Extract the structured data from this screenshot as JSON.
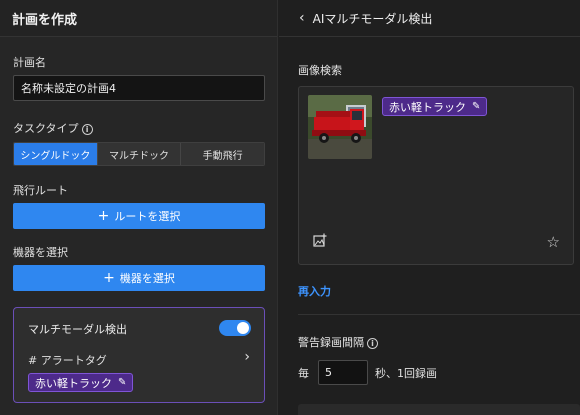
{
  "left": {
    "title": "計画を作成",
    "plan_name_label": "計画名",
    "plan_name_value": "名称未設定の計画4",
    "task_type_label": "タスクタイプ",
    "task_types": [
      "シングルドック",
      "マルチドック",
      "手動飛行"
    ],
    "task_type_selected": "シングルドック",
    "route_label": "飛行ルート",
    "route_button": "ルートを選択",
    "device_label": "機器を選択",
    "device_button": "機器を選択",
    "multimodal_label": "マルチモーダル検出",
    "multimodal_enabled": true,
    "alert_tag_label": "# アラートタグ",
    "alert_tag_value": "赤い軽トラック"
  },
  "right": {
    "title": "AIマルチモーダル検出",
    "image_search_label": "画像検索",
    "tag_value": "赤い軽トラック",
    "reenter_link": "再入力",
    "interval_label": "警告録画間隔",
    "interval_prefix": "毎",
    "interval_value": "5",
    "interval_suffix": "秒、1回録画"
  },
  "icons": {
    "info": "info-icon",
    "plus": "plus-icon",
    "pen": "pen-icon",
    "chevron": "chevron-right-icon",
    "back": "chevron-left-icon",
    "image_add": "image-add-icon",
    "star": "star-icon"
  },
  "colors": {
    "accent_blue": "#2f87f0",
    "tag_purple": "#4d2a8a",
    "card_border": "#6b4fb8",
    "link_blue": "#3d94ff"
  }
}
